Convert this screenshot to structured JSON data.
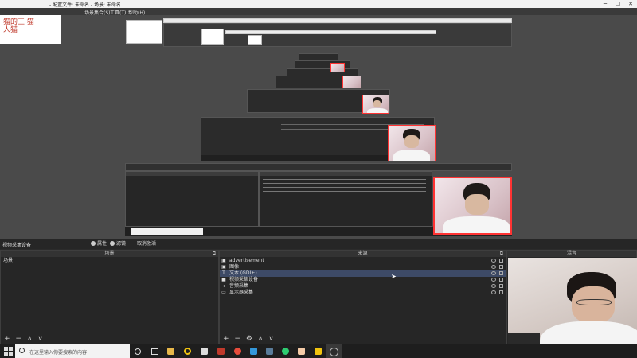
{
  "window": {
    "title": "- 配置文件: 未命名 - 场景: 未命名",
    "controls": [
      "─",
      "☐",
      "✕"
    ]
  },
  "menu": {
    "items": [
      "场景集合(S)",
      "工具(T)",
      "帮助(H)"
    ]
  },
  "logo": {
    "text": "猫的王 猫人猫"
  },
  "status": {
    "label": "视频采集设备",
    "properties_label": "属性",
    "filters_label": "滤镜",
    "refresh_label": "取消激活"
  },
  "scenes_panel": {
    "title": "场景",
    "items": [
      "场景"
    ],
    "tools": [
      "+",
      "−",
      "∧",
      "∨"
    ]
  },
  "sources_panel": {
    "title": "来源",
    "items": [
      {
        "label": "advertisement",
        "icon": "image-icon",
        "icon_glyph": "▣"
      },
      {
        "label": "图像",
        "icon": "image-icon",
        "icon_glyph": "▣"
      },
      {
        "label": "文本 (GDI+)",
        "icon": "text-icon",
        "icon_glyph": "T"
      },
      {
        "label": "视频采集设备",
        "icon": "camera-icon",
        "icon_glyph": "■"
      },
      {
        "label": "音频采集",
        "icon": "audio-icon",
        "icon_glyph": "◂"
      },
      {
        "label": "显示器采集",
        "icon": "monitor-icon",
        "icon_glyph": "▭"
      }
    ],
    "tools": [
      "+",
      "−",
      "⚙",
      "∧",
      "∨"
    ]
  },
  "mixer_panel": {
    "title": "混音"
  },
  "taskbar": {
    "search_placeholder": "在这里输入你要搜索的内容",
    "icons": [
      "task-view-icon",
      "cortana-icon",
      "explorer-icon",
      "chrome-icon",
      "mail-icon",
      "weibo-icon",
      "steam-icon",
      "app-icon",
      "edge-icon",
      "store-icon",
      "photos-icon",
      "obs-icon"
    ]
  },
  "colors": {
    "accent_red": "#ff3333",
    "background": "#2b2b2b",
    "preview_bg": "#4a4a4a"
  }
}
